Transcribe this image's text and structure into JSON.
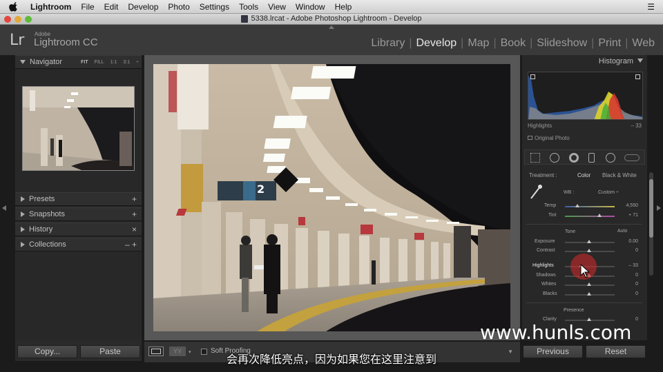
{
  "menubar": {
    "items": [
      "Lightroom",
      "File",
      "Edit",
      "Develop",
      "Photo",
      "Settings",
      "Tools",
      "View",
      "Window",
      "Help"
    ]
  },
  "window": {
    "title": "5338.lrcat - Adobe Photoshop Lightroom - Develop"
  },
  "identity": {
    "logo": "Lr",
    "adobe": "Adobe",
    "product": "Lightroom CC"
  },
  "modules": [
    "Library",
    "Develop",
    "Map",
    "Book",
    "Slideshow",
    "Print",
    "Web"
  ],
  "active_module": "Develop",
  "left_panel": {
    "navigator": {
      "title": "Navigator",
      "zoom": [
        "FIT",
        "FILL",
        "1:1",
        "3:1"
      ]
    },
    "sections": [
      {
        "label": "Presets",
        "action": "+"
      },
      {
        "label": "Snapshots",
        "action": "+"
      },
      {
        "label": "History",
        "action": "×"
      },
      {
        "label": "Collections",
        "action": "– +"
      }
    ],
    "copy_label": "Copy...",
    "paste_label": "Paste"
  },
  "toolbar": {
    "soft_proof": "Soft Proofing"
  },
  "right_panel": {
    "histogram_title": "Histogram",
    "histo_info_label": "Highlights",
    "histo_info_value": "– 33",
    "original_photo": "Original Photo",
    "treatment_label": "Treatment :",
    "treatment_color": "Color",
    "treatment_bw": "Black & White",
    "wb_label": "WB :",
    "wb_value": "Custom ÷",
    "temp_label": "Temp",
    "temp_value": "4,550",
    "tint_label": "Tint",
    "tint_value": "+ 71",
    "tone_label": "Tone",
    "auto_label": "Auto",
    "exposure_label": "Exposure",
    "exposure_value": "0.00",
    "contrast_label": "Contrast",
    "contrast_value": "0",
    "highlights_label": "Highlights",
    "highlights_value": "– 33",
    "shadows_label": "Shadows",
    "shadows_value": "0",
    "whites_label": "Whites",
    "whites_value": "0",
    "blacks_label": "Blacks",
    "blacks_value": "0",
    "presence_label": "Presence",
    "clarity_label": "Clarity",
    "clarity_value": "0",
    "previous_label": "Previous",
    "reset_label": "Reset"
  },
  "photo": {
    "sign_number": "2"
  },
  "subtitle": "会再次降低亮点，因为如果您在这里注意到",
  "watermark": "www.hunls.com"
}
